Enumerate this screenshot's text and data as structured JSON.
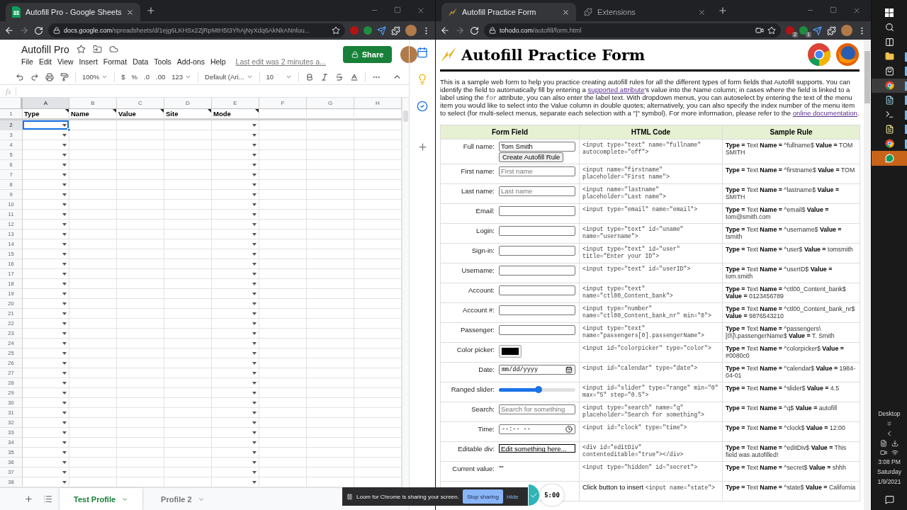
{
  "left_window": {
    "tabs": [
      {
        "title": "Autofill Pro - Google Sheets",
        "selected": true
      }
    ],
    "address": {
      "domain": "docs.google.com",
      "path": "/spreadsheets/d/1ejg6LKHSx2ZjRpMtH5t3YhAjNyXdq6AkNkANnluu..."
    },
    "extensions": [
      {
        "color": "#b31412"
      },
      {
        "color": "#1e8e3e"
      }
    ],
    "sheet": {
      "title": "Autofill Pro",
      "menu": [
        "File",
        "Edit",
        "View",
        "Insert",
        "Format",
        "Data",
        "Tools",
        "Add-ons",
        "Help"
      ],
      "last_edit": "Last edit was 2 minutes a...",
      "share": "Share",
      "toolbar": {
        "zoom": "100%",
        "currency": "$",
        "percent": "%",
        "decrease_decimals": ".0",
        "increase_decimals": ".00",
        "number_format": "123",
        "font": "Default (Ari...",
        "font_size": "10"
      },
      "formula_label": "fx",
      "columns": [
        {
          "letter": "A",
          "selected": true,
          "dropdown": true
        },
        {
          "letter": "B",
          "selected": false,
          "dropdown": false
        },
        {
          "letter": "C",
          "selected": false,
          "dropdown": false
        },
        {
          "letter": "D",
          "selected": false,
          "dropdown": false
        },
        {
          "letter": "E",
          "selected": false,
          "dropdown": true
        },
        {
          "letter": "F",
          "selected": false,
          "dropdown": false
        },
        {
          "letter": "G",
          "selected": false,
          "dropdown": false
        },
        {
          "letter": "H",
          "selected": false,
          "dropdown": false
        }
      ],
      "header_row": {
        "number": "1",
        "cells": [
          {
            "text": "Type",
            "note": true
          },
          {
            "text": "Name",
            "note": true
          },
          {
            "text": "Value",
            "note": true
          },
          {
            "text": "Site",
            "note": true
          },
          {
            "text": "Mode",
            "note": true
          }
        ]
      },
      "rows": [
        {
          "number": "2",
          "selected": true
        },
        {
          "number": "3",
          "selected": false
        },
        {
          "number": "4",
          "selected": false
        },
        {
          "number": "5",
          "selected": false
        },
        {
          "number": "6",
          "selected": false
        },
        {
          "number": "7",
          "selected": false
        },
        {
          "number": "8",
          "selected": false
        },
        {
          "number": "9",
          "selected": false
        },
        {
          "number": "10",
          "selected": false
        },
        {
          "number": "11",
          "selected": false
        },
        {
          "number": "12",
          "selected": false
        },
        {
          "number": "13",
          "selected": false
        },
        {
          "number": "14",
          "selected": false
        },
        {
          "number": "15",
          "selected": false
        },
        {
          "number": "16",
          "selected": false
        },
        {
          "number": "17",
          "selected": false
        },
        {
          "number": "18",
          "selected": false
        },
        {
          "number": "19",
          "selected": false
        },
        {
          "number": "20",
          "selected": false
        },
        {
          "number": "21",
          "selected": false
        },
        {
          "number": "22",
          "selected": false
        },
        {
          "number": "23",
          "selected": false
        },
        {
          "number": "24",
          "selected": false
        },
        {
          "number": "25",
          "selected": false
        },
        {
          "number": "26",
          "selected": false
        },
        {
          "number": "27",
          "selected": false
        },
        {
          "number": "28",
          "selected": false
        },
        {
          "number": "29",
          "selected": false
        },
        {
          "number": "30",
          "selected": false
        },
        {
          "number": "31",
          "selected": false
        },
        {
          "number": "32",
          "selected": false
        },
        {
          "number": "33",
          "selected": false
        },
        {
          "number": "34",
          "selected": false
        },
        {
          "number": "35",
          "selected": false
        },
        {
          "number": "36",
          "selected": false
        },
        {
          "number": "37",
          "selected": false
        },
        {
          "number": "38",
          "selected": false
        }
      ],
      "sheet_tabs": [
        {
          "label": "Test Profile",
          "selected": true
        },
        {
          "label": "Profile 2",
          "selected": false
        }
      ]
    }
  },
  "right_window": {
    "tabs": [
      {
        "title": "Autofill Practice Form",
        "selected": true
      },
      {
        "title": "Extensions",
        "selected": false
      }
    ],
    "address": {
      "domain": "tohodo.com",
      "path": "/autofill/form.html"
    },
    "extensions": [
      {
        "color": "#b31412",
        "badge": "2"
      },
      {
        "color": "#1e8e3e",
        "badge": "1"
      }
    ],
    "page": {
      "title": "Autofill Practice Form",
      "intro": [
        {
          "kind": "text",
          "text": "This is a sample web form to help you practice creating autofill rules for all the different types of form fields that Autofill supports. You can identify the field to automatically fill by entering a "
        },
        {
          "kind": "link",
          "text": "supported attribute"
        },
        {
          "kind": "text",
          "text": "'s value into the Name column; in cases where the field is linked to a label using the "
        },
        {
          "kind": "code",
          "text": "for"
        },
        {
          "kind": "text",
          "text": " attribute, you can also enter the label text. With dropdown menus, you can autoselect by entering the text of the menu item you would like to select into the Value column in double quotes; alternatively, you can also specify the index number of the menu item to select (for multi-select menus, separate each selection with a \"|\" symbol). For more information, please refer to the "
        },
        {
          "kind": "link",
          "text": "online documentation"
        },
        {
          "kind": "text",
          "text": "."
        }
      ],
      "table": {
        "columns": [
          "Form Field",
          "HTML Code",
          "Sample Rule"
        ],
        "rows": [
          {
            "kind": "text_button",
            "label": "Full name:",
            "value": "Tom Smith",
            "button": "Create Autofill Rule",
            "html": "<input type=\"text\" name=\"fullname\" autocomplete=\"off\">",
            "rule": "**Type =** Text **Name =** ^fullname$ **Value =** TOM SMITH"
          },
          {
            "kind": "text",
            "label": "First name:",
            "placeholder": "First name",
            "html": "<input name=\"firstname\" placeholder=\"First name\">",
            "rule": "**Type =** Text **Name =** ^firstname$ **Value =** TOM"
          },
          {
            "kind": "text",
            "label": "Last name:",
            "placeholder": "Last name",
            "html": "<input name=\"lastname\" placeholder=\"Last name\">",
            "rule": "**Type =** Text **Name =** ^lastname$ **Value =** SMITH"
          },
          {
            "kind": "text",
            "label": "Email:",
            "html": "<input type=\"email\" name=\"email\">",
            "rule": "**Type =** Text **Name =** ^email$ **Value =** tom@smith.com"
          },
          {
            "kind": "text",
            "label": "Login:",
            "html": "<input type=\"text\" id=\"uname\" name=\"username\">",
            "rule": "**Type =** Text **Name =** ^username$ **Value =** tsmith"
          },
          {
            "kind": "text",
            "label": "Sign-in:",
            "html": "<input type=\"text\" id=\"user\" title=\"Enter your ID\">",
            "rule": "**Type =** Text **Name =** ^user$ **Value =** tomsmith"
          },
          {
            "kind": "text",
            "label": "Username:",
            "html": "<input type=\"text\" id=\"userID\">",
            "rule": "**Type =** Text **Name =** ^userID$ **Value =** tom.smith"
          },
          {
            "kind": "text",
            "label": "Account:",
            "html": "<input type=\"text\" name=\"ctl00_Content_bank\">",
            "rule": "**Type =** Text **Name =** ^ctl00_Content_bank$ **Value =** 0123456789"
          },
          {
            "kind": "text",
            "label": "Account #:",
            "html": "<input type=\"number\" name=\"ctl00_Content_bank_nr\" min=\"0\">",
            "rule": "**Type =** Text **Name =** ^ctl00_Content_bank_nr$ **Value =** 9876543210"
          },
          {
            "kind": "text",
            "label": "Passenger:",
            "html": "<input type=\"text\" name=\"passengers[0].passengerName\">",
            "rule": "**Type =** Text **Name =** ^passengers\\[0\\]\\.passengerName$ **Value =** T. Smith"
          },
          {
            "kind": "color",
            "label": "Color picker:",
            "color": "#000000",
            "html": "<input id=\"colorpicker\" type=\"color\">",
            "rule": "**Type =** Text **Name =** ^colorpicker$ **Value =** #0080c0"
          },
          {
            "kind": "date",
            "label": "Date:",
            "value": "mm/dd/yyyy",
            "html": "<input id=\"calendar\" type=\"date\">",
            "rule": "**Type =** Text **Name =** ^calendar$ **Value =** 1984-04-01"
          },
          {
            "kind": "range",
            "label": "Ranged slider:",
            "level": 0.52,
            "html": "<input id=\"slider\" type=\"range\" min=\"0\" max=\"5\" step=\"0.5\">",
            "rule": "**Type =** Text **Name =** ^slider$ **Value =** 4.5"
          },
          {
            "kind": "text",
            "label": "Search:",
            "placeholder": "Search for something",
            "html": "<input type=\"search\" name=\"q\" placeholder=\"Search for something\">",
            "rule": "**Type =** Text **Name =** ^q$ **Value =** autofill"
          },
          {
            "kind": "time",
            "label": "Time:",
            "value": "--:-- --",
            "html": "<input id=\"clock\" type=\"time\">",
            "rule": "**Type =** Text **Name =** ^clock$ **Value =** 12:00"
          },
          {
            "kind": "editable",
            "label": "Editable div:",
            "value": "Edit something here...",
            "html": "<div id=\"editDiv\" contenteditable=\"true\"></div>",
            "rule": "**Type =** Text **Name =** ^editDiv$ **Value =** This field was autofilled!"
          },
          {
            "kind": "plain",
            "label": "Current value:",
            "value": "\"\"",
            "html": "<input type=\"hidden\" id=\"secret\">",
            "rule": "**Type =** Text **Name =** ^secret$ **Value =** shhh"
          },
          {
            "kind": "covered",
            "html_note": "Click button to insert",
            "html": "<input name=\"state\">",
            "rule": "**Type =** Text **Name =** ^state$ **Value =** California"
          }
        ]
      }
    }
  },
  "loom": {
    "text": "Loom for Chrome is sharing your screen.",
    "stop": "Stop sharing",
    "hide": "Hide",
    "timer": "5:00"
  },
  "taskbar": {
    "items": [
      {
        "kind": "start",
        "selected": false,
        "attention": false,
        "running": false
      },
      {
        "kind": "search",
        "selected": false,
        "attention": false,
        "running": false
      },
      {
        "kind": "taskview",
        "selected": false,
        "attention": false,
        "running": false
      },
      {
        "kind": "explorer",
        "selected": false,
        "attention": false,
        "running": true
      },
      {
        "kind": "store",
        "selected": false,
        "attention": false,
        "running": true
      },
      {
        "kind": "chrome",
        "selected": true,
        "attention": false,
        "running": true
      },
      {
        "kind": "notepad",
        "selected": false,
        "attention": false,
        "running": true
      },
      {
        "kind": "terminal",
        "selected": false,
        "attention": false,
        "running": true
      },
      {
        "kind": "document",
        "selected": false,
        "attention": false,
        "running": true
      },
      {
        "kind": "chrome",
        "selected": false,
        "attention": false,
        "running": true
      },
      {
        "kind": "hangouts",
        "selected": false,
        "attention": true,
        "running": false
      }
    ],
    "tray": {
      "desktop": "Desktop",
      "time": "3:08 PM",
      "day": "Saturday",
      "date": "1/9/2021"
    }
  }
}
